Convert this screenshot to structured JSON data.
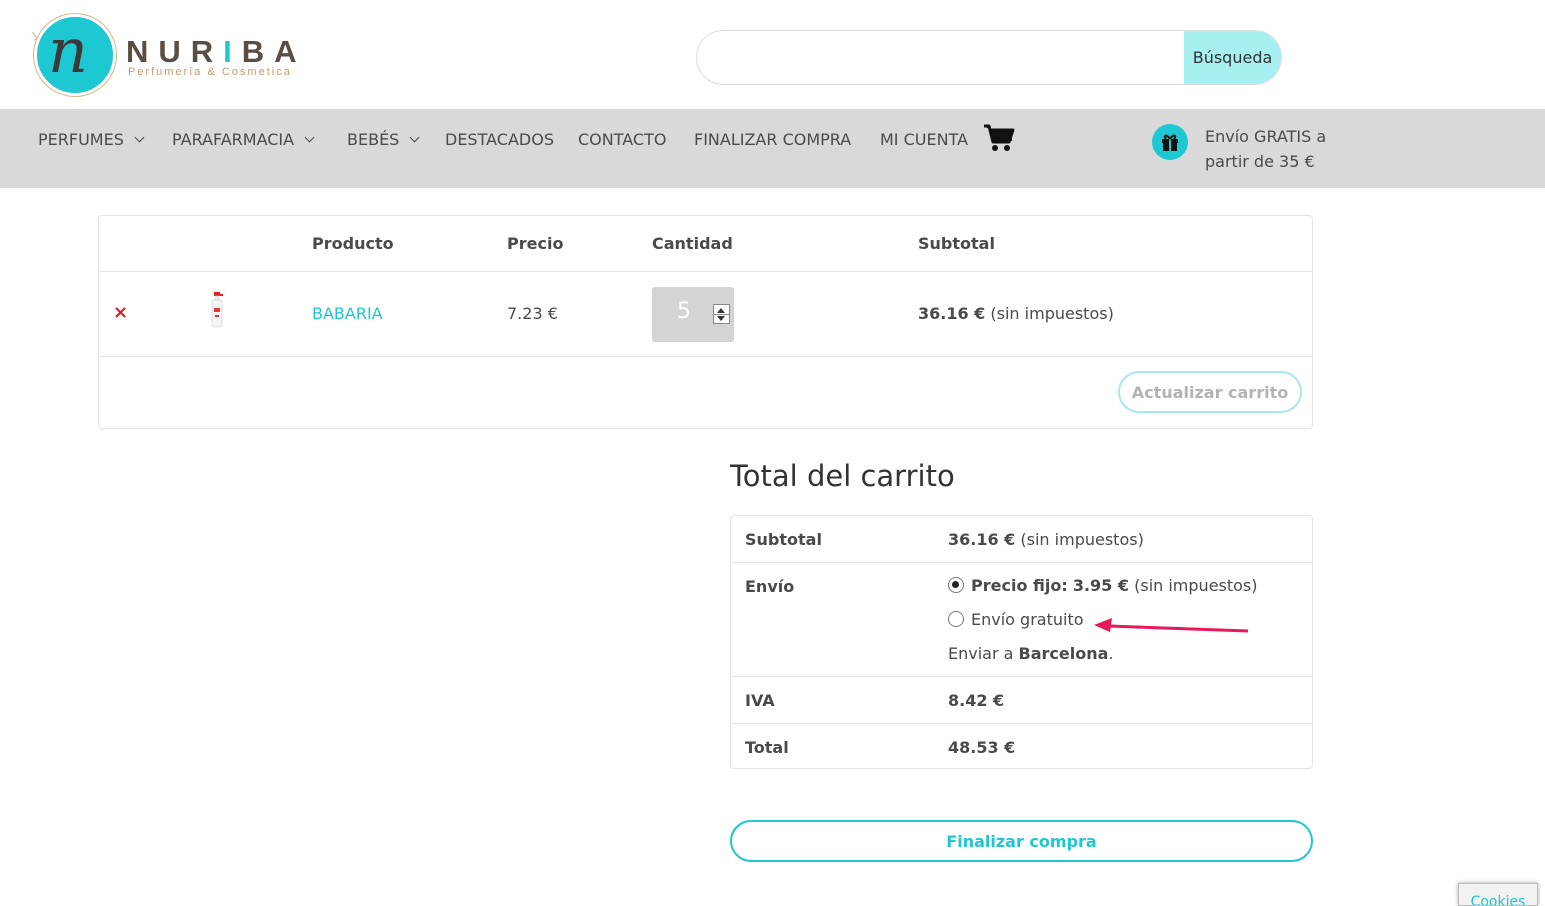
{
  "brand": {
    "name_part1": "NUR",
    "name_part2": "I",
    "name_part3": "BA",
    "tagline": "Perfumería & Cosmetica",
    "logo_letter": "n"
  },
  "search": {
    "placeholder": "",
    "value": "",
    "button_label": "Búsqueda"
  },
  "nav": {
    "items": [
      {
        "label": "PERFUMES",
        "has_dropdown": true
      },
      {
        "label": "PARAFARMACIA",
        "has_dropdown": true
      },
      {
        "label": "BEBÉS",
        "has_dropdown": true
      },
      {
        "label": "DESTACADOS",
        "has_dropdown": false
      },
      {
        "label": "CONTACTO",
        "has_dropdown": false
      },
      {
        "label": "FINALIZAR COMPRA",
        "has_dropdown": false
      },
      {
        "label": "MI CUENTA",
        "has_dropdown": false
      }
    ],
    "cart_icon": "shopping-cart-icon",
    "shipping_icon": "gift-icon",
    "shipping_line1": "Envío GRATIS a",
    "shipping_line2": "partir de 35 €"
  },
  "cart": {
    "headers": {
      "product": "Producto",
      "price": "Precio",
      "quantity": "Cantidad",
      "subtotal": "Subtotal"
    },
    "items": [
      {
        "remove_symbol": "×",
        "name": "BABARIA",
        "price": "7.23 €",
        "quantity": "5",
        "subtotal": "36.16 €",
        "subtotal_note": "(sin impuestos)"
      }
    ],
    "update_label": "Actualizar carrito"
  },
  "totals": {
    "title": "Total del carrito",
    "subtotal_label": "Subtotal",
    "subtotal_value": "36.16 €",
    "subtotal_note": "(sin impuestos)",
    "shipping_label": "Envío",
    "shipping_options": [
      {
        "label_prefix": "Precio fijo:",
        "price": "3.95 €",
        "note": "(sin impuestos)",
        "checked": true
      },
      {
        "label_prefix": "Envío gratuito",
        "price": "",
        "note": "",
        "checked": false
      }
    ],
    "ship_to_prefix": "Enviar a",
    "ship_to_city": "Barcelona",
    "ship_to_suffix": ".",
    "tax_label": "IVA",
    "tax_value": "8.42 €",
    "total_label": "Total",
    "total_value": "48.53 €"
  },
  "checkout_label": "Finalizar compra",
  "cookies_label": "Cookies",
  "colors": {
    "accent": "#1ec8d2",
    "nav_bg": "#d9d9d9",
    "remove": "#e01a1a",
    "annotation_arrow": "#e8185a"
  }
}
